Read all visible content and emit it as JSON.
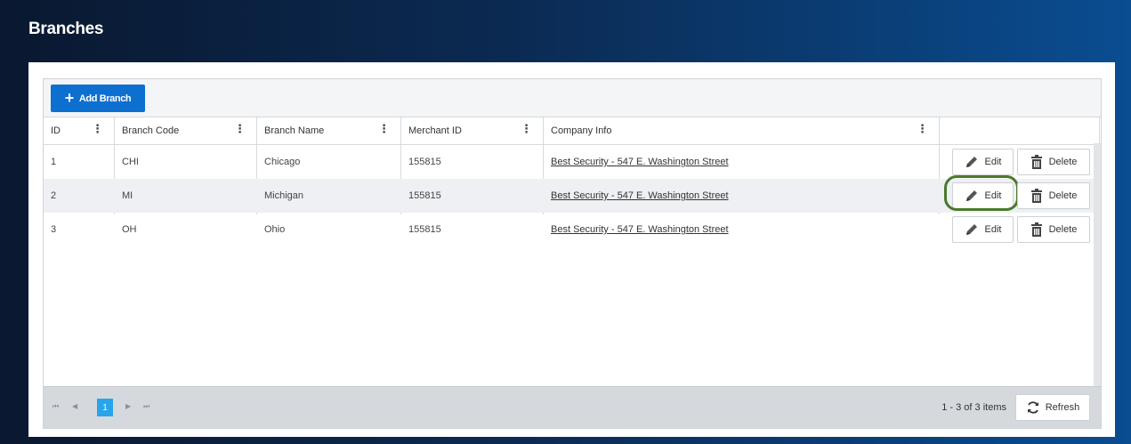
{
  "page": {
    "title": "Branches"
  },
  "toolbar": {
    "add_label": "Add Branch"
  },
  "columns": [
    {
      "label": "ID"
    },
    {
      "label": "Branch Code"
    },
    {
      "label": "Branch Name"
    },
    {
      "label": "Merchant ID"
    },
    {
      "label": "Company Info"
    }
  ],
  "rows": [
    {
      "id": "1",
      "code": "CHI",
      "name": "Chicago",
      "merchant": "155815",
      "company": "Best Security - 547 E. Washington Street"
    },
    {
      "id": "2",
      "code": "MI",
      "name": "Michigan",
      "merchant": "155815",
      "company": "Best Security - 547 E. Washington Street"
    },
    {
      "id": "3",
      "code": "OH",
      "name": "Ohio",
      "merchant": "155815",
      "company": "Best Security - 547 E. Washington Street"
    }
  ],
  "actions": {
    "edit_label": "Edit",
    "delete_label": "Delete"
  },
  "pager": {
    "first": "⏮",
    "prev": "◀",
    "current": "1",
    "next": "▶",
    "last": "⏭",
    "items_label": "1 - 3 of 3 items",
    "refresh_label": "Refresh"
  },
  "colors": {
    "accent": "#0d6fd0",
    "current_page": "#28a4ea",
    "highlight": "#4a7a2c"
  }
}
